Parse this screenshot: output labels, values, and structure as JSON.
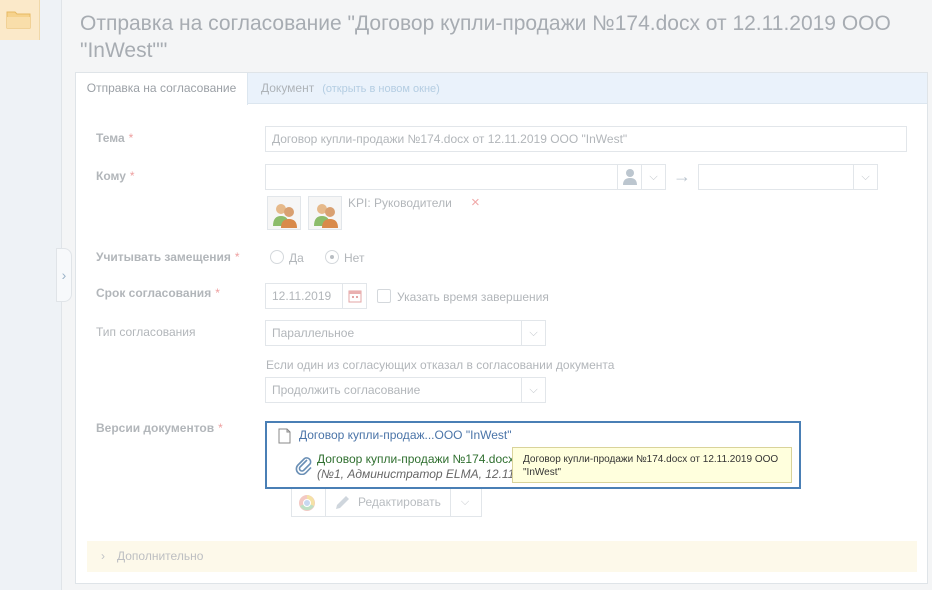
{
  "page": {
    "title": "Отправка на согласование \"Договор купли-продажи №174.docx от 12.11.2019 ООО \"InWest\"\""
  },
  "tabs": {
    "send": "Отправка на согласование",
    "document": "Документ",
    "open_new_window": "(открыть в новом окне)"
  },
  "form": {
    "subject": {
      "label": "Тема",
      "value": "Договор купли-продажи №174.docx от 12.11.2019 ООО \"InWest\""
    },
    "to": {
      "label": "Кому",
      "value": "",
      "target_value": "",
      "recipient_group": "KPI: Руководители",
      "remove_glyph": "×"
    },
    "substitutions": {
      "label": "Учитывать замещения",
      "option_yes": "Да",
      "option_no": "Нет",
      "selected": "Нет"
    },
    "deadline": {
      "label": "Срок согласования",
      "value": "12.11.2019",
      "checkbox_label": "Указать время завершения"
    },
    "approval_type": {
      "label": "Тип согласования",
      "value": "Параллельное"
    },
    "reject_rule": {
      "caption": "Если один из согласующих отказал в согласовании документа",
      "value": "Продолжить согласование"
    },
    "versions": {
      "label": "Версии документов",
      "document_link": "Договор купли-продаж...ООО \"InWest\"",
      "version_link": "Договор купли-продажи №174.docx",
      "version_meta": "(№1, Администратор ELMA, 12.11",
      "tooltip": "Договор купли-продажи №174.docx от 12.11.2019 ООО \"InWest\"",
      "edit_button": "Редактировать"
    },
    "required_mark": "*"
  },
  "extra": {
    "label": "Дополнительно"
  },
  "glyphs": {
    "expand": "›",
    "arrow": "→",
    "dropdown": "⌵",
    "chevron_right": "›"
  },
  "colors": {
    "accent": "#4a7fb5",
    "link": "#4a74a8",
    "version_link": "#2f6f2f",
    "tooltip_bg": "#ffffdd",
    "required": "#ee9f9f"
  }
}
